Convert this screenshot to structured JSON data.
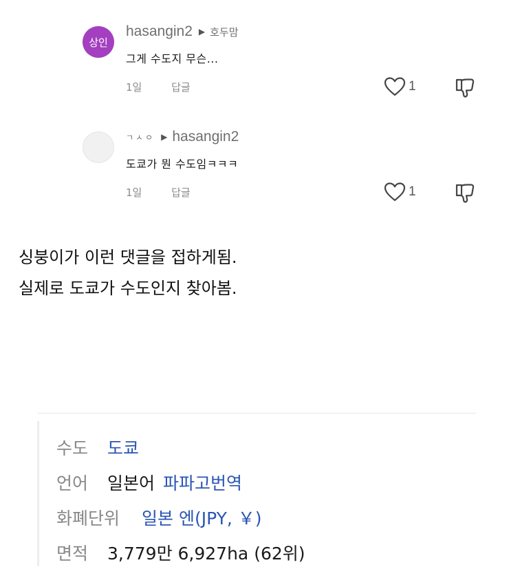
{
  "comments": [
    {
      "avatar_text": "상인",
      "username": "hasangin2",
      "reply_arrow": "▶",
      "reply_to": "호두맘",
      "text": "그게 수도지 무슨...",
      "time": "1일",
      "reply_label": "답글",
      "like_count": "1"
    },
    {
      "avatar_text": "",
      "username": "ㄱㅅㅇ",
      "reply_arrow": "▶",
      "reply_to": "hasangin2",
      "text": "도쿄가 뭔 수도임ㅋㅋㅋ",
      "time": "1일",
      "reply_label": "답글",
      "like_count": "1"
    }
  ],
  "narration": [
    "싱붕이가 이런 댓글을 접하게됨.",
    "실제로 도쿄가 수도인지 찾아봄."
  ],
  "info": {
    "capital_label": "수도",
    "capital_value": "도쿄",
    "language_label": "언어",
    "language_value": "일본어",
    "language_link": "파파고번역",
    "currency_label": "화폐단위",
    "currency_value": "일본 엔(JPY, ￥)",
    "area_label": "면적",
    "area_value": "3,779만 6,927ha (62위)"
  },
  "icons": {
    "heart": "heart-outline-icon",
    "dislike": "thumbs-down-icon"
  },
  "colors": {
    "avatar_purple": "#a43fc0",
    "link_blue": "#2a55b3",
    "muted_gray": "#8a8a8a"
  }
}
